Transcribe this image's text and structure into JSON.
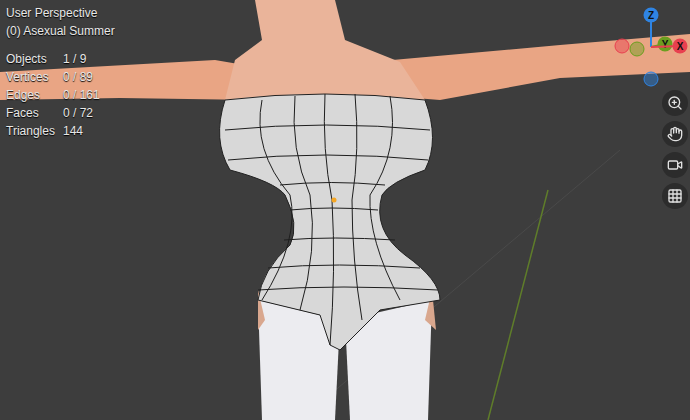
{
  "viewport": {
    "view": "User Perspective",
    "object": "(0) Asexual Summer"
  },
  "stats": [
    {
      "label": "Objects",
      "value": "1 / 9"
    },
    {
      "label": "Vertices",
      "value": "0 / 89"
    },
    {
      "label": "Edges",
      "value": "0 / 161"
    },
    {
      "label": "Faces",
      "value": "0 / 72"
    },
    {
      "label": "Triangles",
      "value": "144"
    }
  ],
  "gizmo": [
    {
      "label": "Z",
      "color": "#2f84e3"
    },
    {
      "label": "Y",
      "color": "#6b9e1f"
    },
    {
      "label": "X",
      "color": "#e8404f"
    }
  ]
}
